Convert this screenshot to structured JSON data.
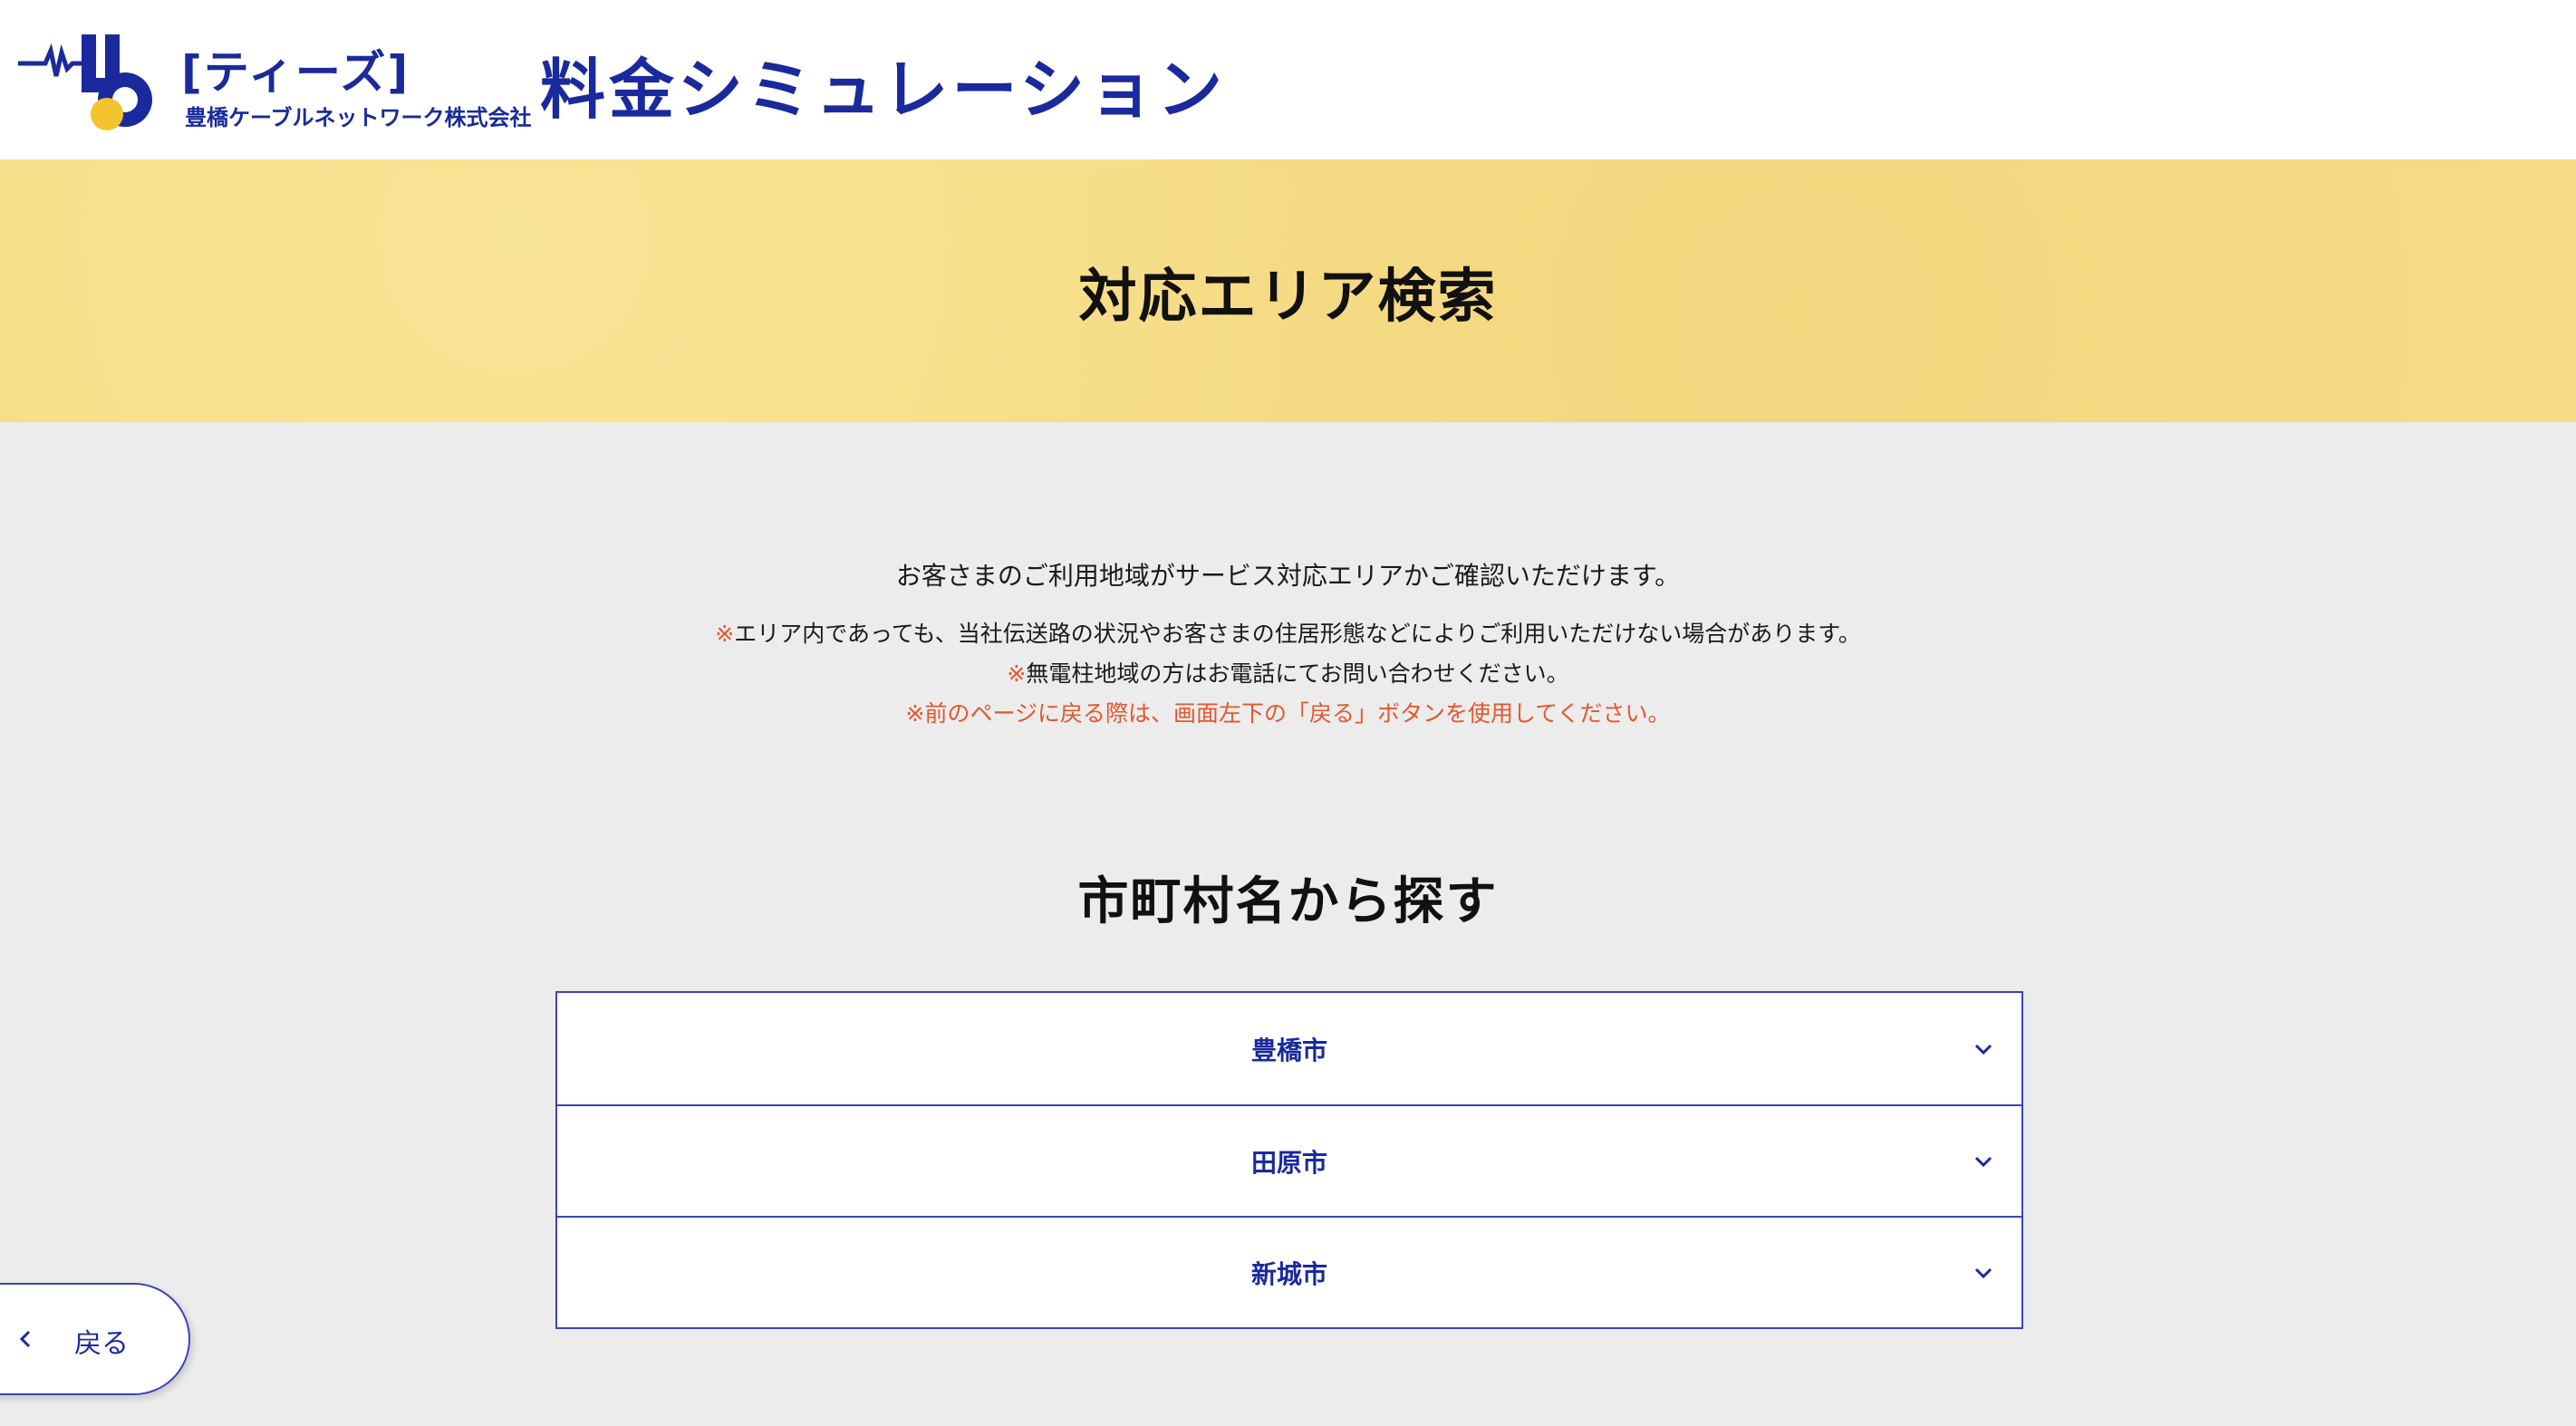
{
  "header": {
    "logo_name": "[ティーズ]",
    "logo_company": "豊橋ケーブルネットワーク株式会社",
    "title": "料金シミュレーション"
  },
  "banner": {
    "title": "対応エリア検索"
  },
  "notes": {
    "intro": "お客さまのご利用地域がサービス対応エリアかご確認いただけます。",
    "mark": "※",
    "line1": "エリア内であっても、当社伝送路の状況やお客さまの住居形態などによりご利用いただけない場合があります。",
    "line2": "無電柱地域の方はお電話にてお問い合わせください。",
    "line3": "※前のページに戻る際は、画面左下の「戻る」ボタンを使用してください。"
  },
  "section": {
    "title": "市町村名から探す"
  },
  "cities": [
    {
      "label": "豊橋市"
    },
    {
      "label": "田原市"
    },
    {
      "label": "新城市"
    }
  ],
  "back_button": {
    "label": "戻る"
  },
  "colors": {
    "brand": "#1a2a9c",
    "banner": "#f6dc85",
    "background": "#ececec",
    "note_accent": "#e4572e",
    "logo_yellow": "#f4c430"
  }
}
